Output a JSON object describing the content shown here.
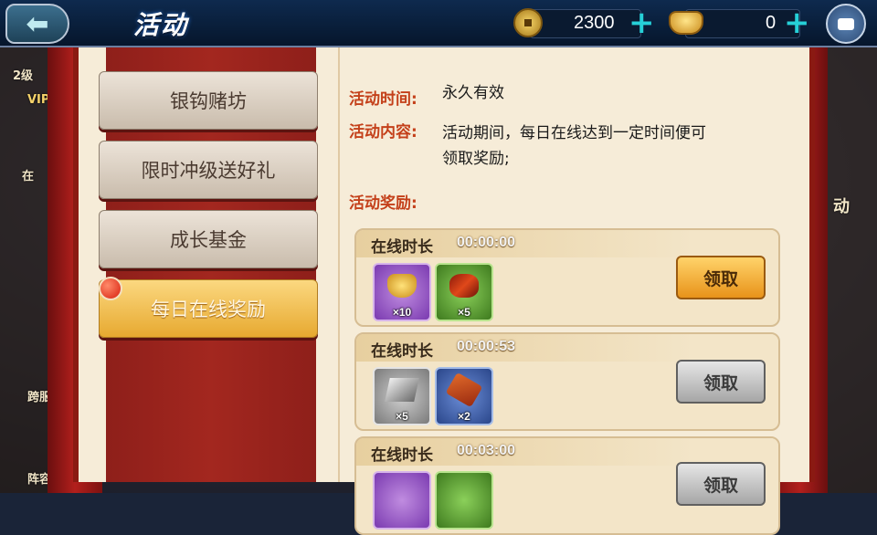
{
  "header": {
    "title": "活动",
    "coins": "2300",
    "ingots": "0"
  },
  "left_edge": {
    "level": "2级",
    "vip": "VIP",
    "text1": "在",
    "text2": "跨服",
    "text3": "阵容"
  },
  "right_edge": {
    "text1": "动"
  },
  "tabs": [
    {
      "label": "银钩赌坊"
    },
    {
      "label": "限时冲级送好礼"
    },
    {
      "label": "成长基金"
    },
    {
      "label": "每日在线奖励"
    }
  ],
  "detail": {
    "time_label": "活动时间:",
    "time_value": "永久有效",
    "content_label": "活动内容:",
    "content_line1": "活动期间，每日在线达到一定时间便可",
    "content_line2": "领取奖励;",
    "reward_label": "活动奖励:"
  },
  "rewards": [
    {
      "label": "在线时长",
      "time": "00:00:00",
      "items": [
        "×10",
        "×5"
      ],
      "button": "领取"
    },
    {
      "label": "在线时长",
      "time": "00:00:53",
      "items": [
        "×5",
        "×2"
      ],
      "button": "领取"
    },
    {
      "label": "在线时长",
      "time": "00:03:00",
      "items": [],
      "button": "领取"
    }
  ],
  "colors": {
    "accent_red": "#c4401a",
    "active_tab": "#e7a930",
    "curtain": "#b21f1c"
  }
}
